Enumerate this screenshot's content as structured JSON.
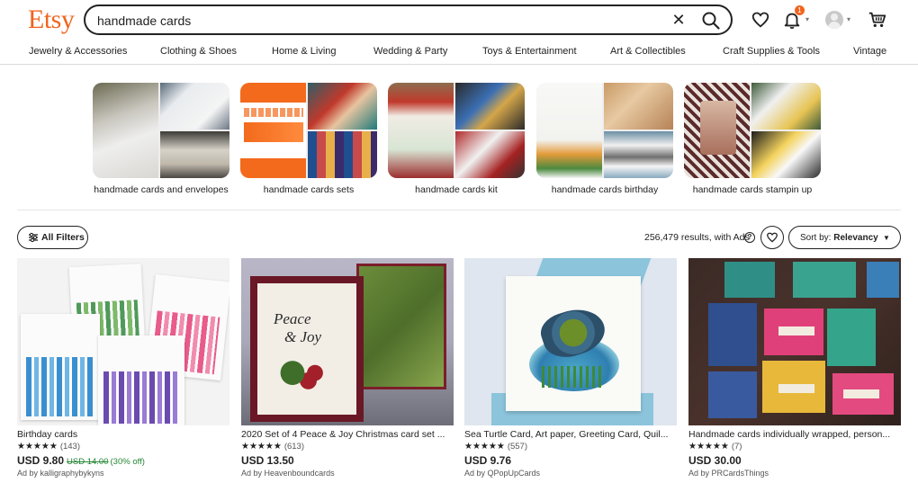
{
  "header": {
    "logo": "Etsy",
    "search_value": "handmade cards",
    "notification_count": "1"
  },
  "categories": [
    "Jewelry & Accessories",
    "Clothing & Shoes",
    "Home & Living",
    "Wedding & Party",
    "Toys & Entertainment",
    "Art & Collectibles",
    "Craft Supplies & Tools",
    "Vintage"
  ],
  "suggestions": [
    {
      "label": "handmade cards and envelopes"
    },
    {
      "label": "handmade cards sets"
    },
    {
      "label": "handmade cards kit"
    },
    {
      "label": "handmade cards birthday"
    },
    {
      "label": "handmade cards stampin up"
    }
  ],
  "toolbar": {
    "filters_label": "All Filters",
    "results_text": "256,479 results, with Ads",
    "sort_prefix": "Sort by:",
    "sort_value": "Relevancy"
  },
  "products": [
    {
      "title": "Birthday cards",
      "stars": "★★★★★",
      "reviews": "(143)",
      "price": "USD 9.80",
      "original_price": "USD 14.00",
      "discount": "(30% off)",
      "seller": "Ad by kalligraphybykyns"
    },
    {
      "title": "2020 Set of 4 Peace & Joy Christmas card set ...",
      "stars": "★★★★★",
      "reviews": "(613)",
      "price": "USD 13.50",
      "original_price": "",
      "discount": "",
      "seller": "Ad by Heavenboundcards"
    },
    {
      "title": "Sea Turtle Card, Art paper, Greeting Card, Quil...",
      "stars": "★★★★★",
      "reviews": "(557)",
      "price": "USD 9.76",
      "original_price": "",
      "discount": "",
      "seller": "Ad by QPopUpCards"
    },
    {
      "title": "Handmade cards individually wrapped, person...",
      "stars": "★★★★★",
      "reviews": "(7)",
      "price": "USD 30.00",
      "original_price": "",
      "discount": "",
      "seller": "Ad by PRCardsThings"
    }
  ],
  "colors": {
    "brand": "#F1641E",
    "sale": "#258635"
  }
}
